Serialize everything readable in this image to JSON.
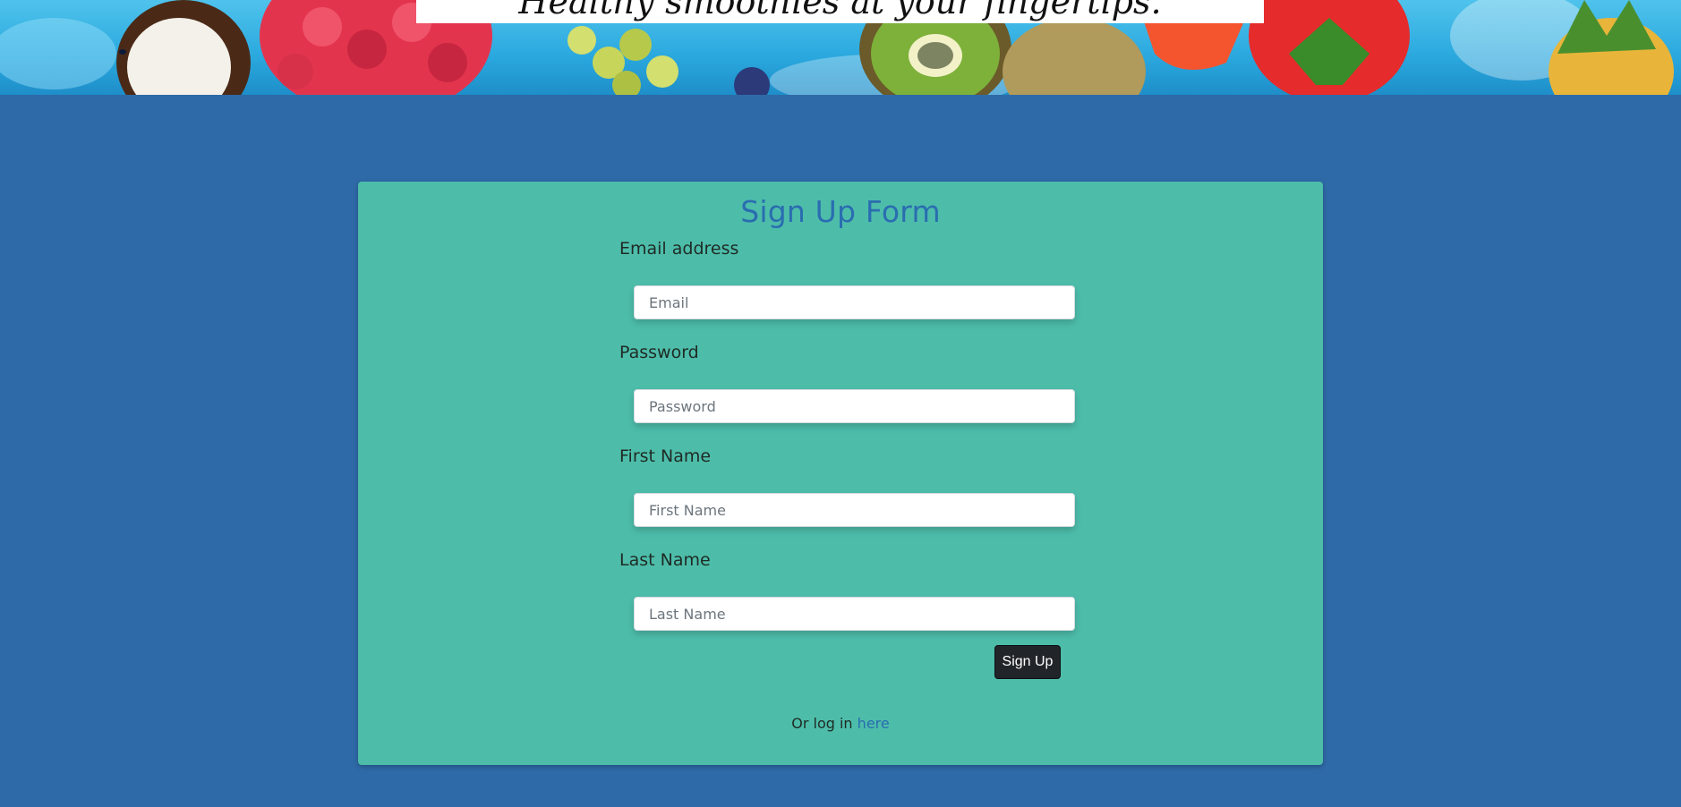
{
  "hero": {
    "tagline": "Healthy smoothies at your fingertips."
  },
  "form": {
    "title": "Sign Up Form",
    "fields": [
      {
        "label": "Email address",
        "placeholder": "Email",
        "value": ""
      },
      {
        "label": "Password",
        "placeholder": "Password",
        "value": ""
      },
      {
        "label": "First Name",
        "placeholder": "First Name",
        "value": ""
      },
      {
        "label": "Last Name",
        "placeholder": "Last Name",
        "value": ""
      }
    ],
    "submit_label": "Sign Up",
    "login_prefix": "Or log in",
    "login_link": "here"
  },
  "colors": {
    "page_background": "#2f6aa8",
    "card_background": "#4dbdaa",
    "title_color": "#2a6db0",
    "button_background": "#212529",
    "link_color": "#2a6db0"
  }
}
